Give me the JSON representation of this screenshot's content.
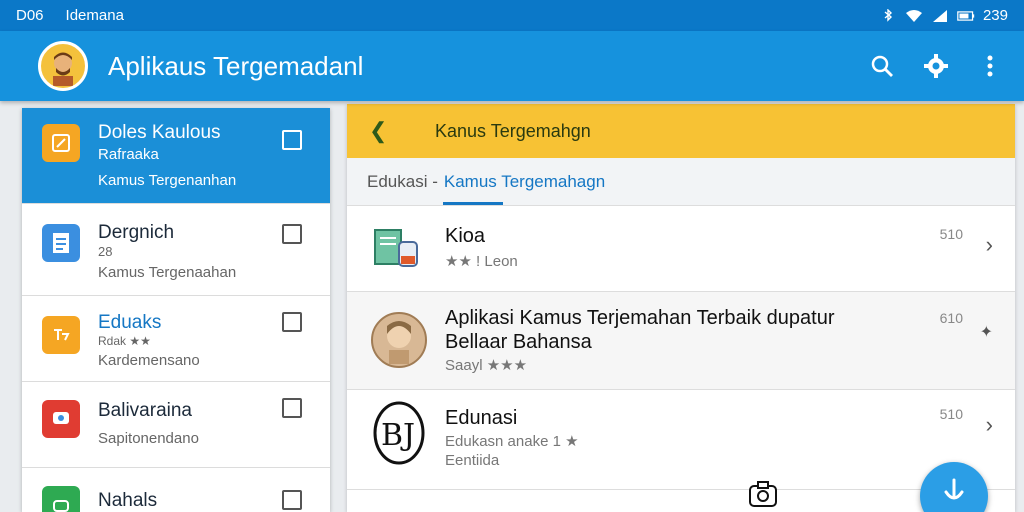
{
  "status_bar": {
    "left_code": "D06",
    "left_text": "Idemana",
    "time": "239"
  },
  "app_bar": {
    "title": "Aplikaus Tergemadanl",
    "actions": [
      "search-icon",
      "gear-icon",
      "more-vert-icon"
    ]
  },
  "left_list": {
    "items": [
      {
        "title": "Doles Kaulous",
        "sub1": "Rafraaka",
        "sub2": "Kamus Tergenanhan",
        "icon_color": "#f5a623"
      },
      {
        "title": "Dergnich",
        "sub1": "28",
        "sub2": "Kamus Tergenaahan",
        "icon_color": "#3b8fe0"
      },
      {
        "title": "Eduaks",
        "sub1": "Rdak ★★",
        "sub2": "Kardemensano",
        "icon_color": "#f5a623"
      },
      {
        "title": "Balivaraina",
        "sub1": "",
        "sub2": "Sapitonendano",
        "icon_color": "#e03c32"
      },
      {
        "title": "Nahals",
        "sub1": "",
        "sub2": "",
        "icon_color": "#2eaa52"
      }
    ]
  },
  "right_panel": {
    "header_title": "Kanus Tergemahgn",
    "breadcrumb_root": "Edukasi -",
    "breadcrumb_active": "Kamus Tergemahagn",
    "rows": [
      {
        "title": "Kioa",
        "sub": "★★ ! Leon",
        "meta": "510"
      },
      {
        "title": "Aplikasi Kamus Terjemahan Terbaik dupatur Bellaar Bahansa",
        "sub": "Saayl ★★★",
        "meta": "610"
      },
      {
        "title": "Edunasi",
        "sub": "Edukasn anake 1 ★",
        "sub2": "Eentiida",
        "meta": "510"
      }
    ]
  },
  "colors": {
    "primary": "#1692dd",
    "status_bar": "#0b78c8",
    "accent_yellow": "#f7c234"
  }
}
